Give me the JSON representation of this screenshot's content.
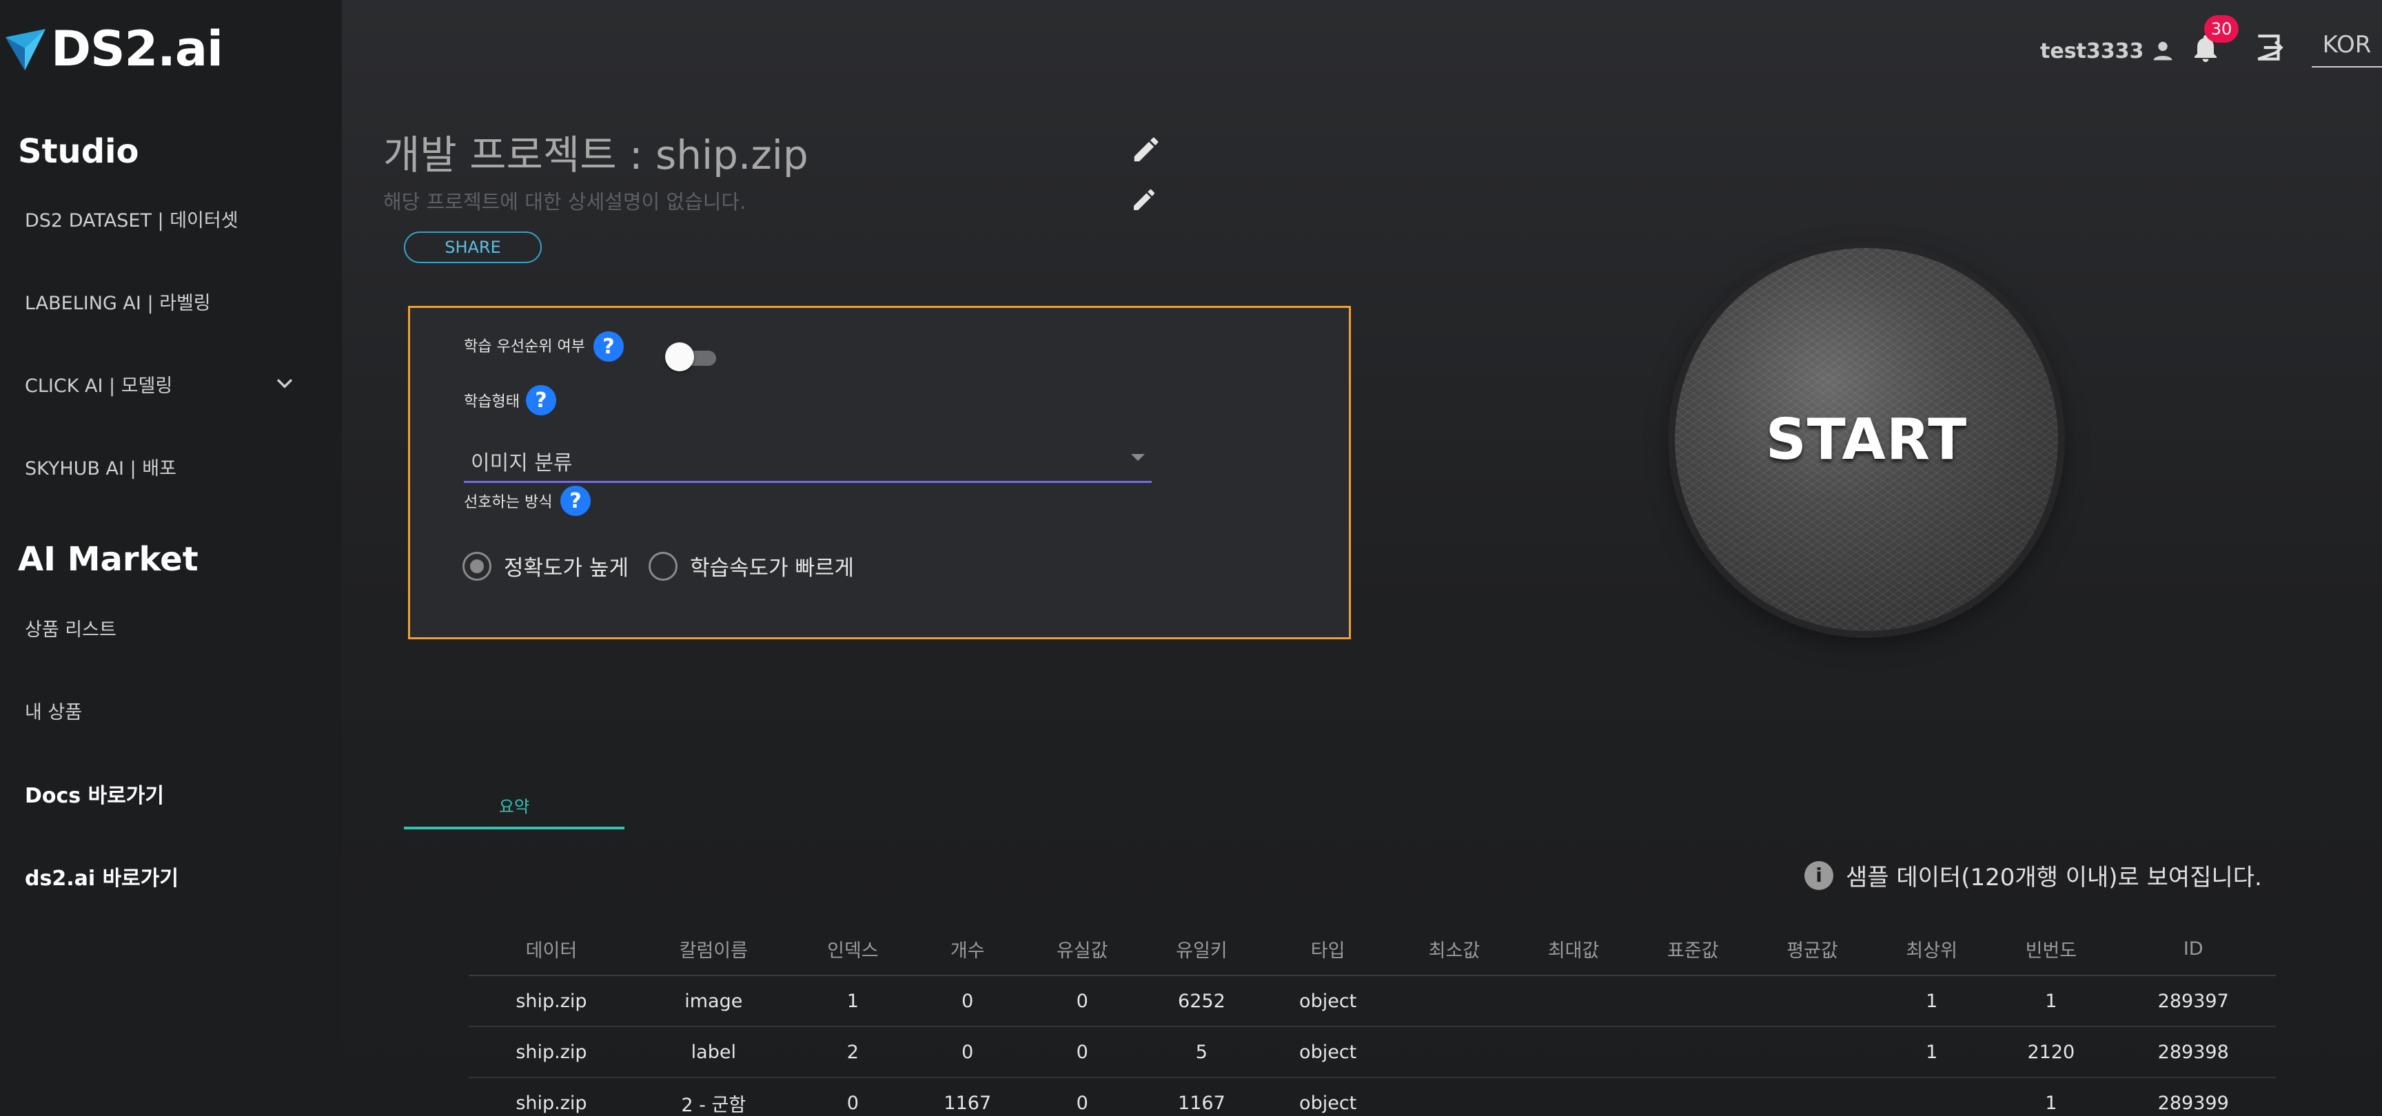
{
  "brand": {
    "name": "DS2.ai"
  },
  "sidebar": {
    "studio_title": "Studio",
    "studio_items": [
      {
        "label": "DS2 DATASET | 데이터셋"
      },
      {
        "label": "LABELING AI | 라벨링"
      },
      {
        "label": "CLICK AI | 모델링"
      },
      {
        "label": "SKYHUB AI | 배포"
      }
    ],
    "market_title": "AI Market",
    "market_items": [
      {
        "label": "상품 리스트"
      },
      {
        "label": "내 상품"
      }
    ],
    "links": [
      {
        "label": "Docs 바로가기"
      },
      {
        "label": "ds2.ai 바로가기"
      }
    ]
  },
  "header": {
    "username": "test3333",
    "notification_count": "30",
    "language": "KOR"
  },
  "project": {
    "title": "개발 프로젝트 : ship.zip",
    "description": "해당 프로젝트에 대한 상세설명이 없습니다.",
    "share_label": "SHARE"
  },
  "options": {
    "priority_label": "학습 우선순위 여부",
    "priority_enabled": false,
    "training_type_label": "학습형태",
    "training_type_value": "이미지 분류",
    "preferred_label": "선호하는 방식",
    "radio_options": [
      {
        "label": "정확도가 높게",
        "selected": true
      },
      {
        "label": "학습속도가 빠르게",
        "selected": false
      }
    ]
  },
  "start_label": "START",
  "tabs": [
    {
      "label": "요약",
      "active": true
    }
  ],
  "sample_note": "샘플 데이터(120개행 이내)로 보여집니다.",
  "table": {
    "headers": [
      "데이터",
      "칼럼이름",
      "인덱스",
      "개수",
      "유실값",
      "유일키",
      "타입",
      "최소값",
      "최대값",
      "표준값",
      "평균값",
      "최상위",
      "빈번도",
      "ID"
    ],
    "rows": [
      [
        "ship.zip",
        "image",
        "1",
        "0",
        "0",
        "6252",
        "object",
        "",
        "",
        "",
        "",
        "1",
        "1",
        "289397"
      ],
      [
        "ship.zip",
        "label",
        "2",
        "0",
        "0",
        "5",
        "object",
        "",
        "",
        "",
        "",
        "1",
        "2120",
        "289398"
      ],
      [
        "ship.zip",
        "2 - 군함",
        "0",
        "1167",
        "0",
        "1167",
        "object",
        "",
        "",
        "",
        "",
        "",
        "1",
        "289399"
      ]
    ]
  },
  "colors": {
    "accent": "#2ec4b6",
    "highlight_border": "#f0a12d",
    "help_icon": "#1f7cff",
    "badge": "#e8134f",
    "select_underline": "#6e6cf0"
  }
}
